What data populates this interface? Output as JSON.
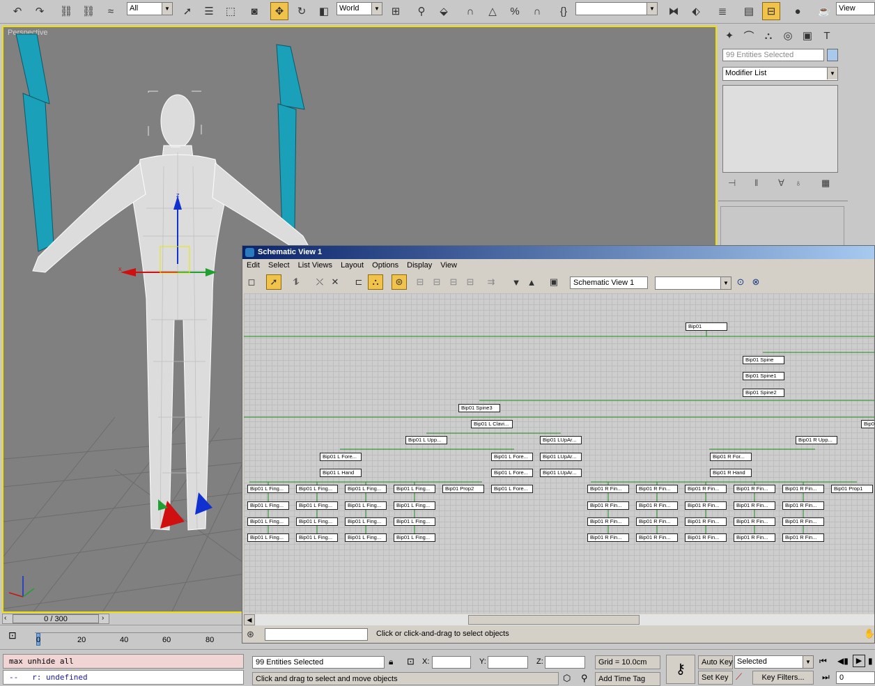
{
  "toolbar": {
    "selection_filter": "All",
    "reference_coord": "World",
    "named_selection": "",
    "view_label": "View"
  },
  "viewport": {
    "label": "Perspective",
    "axis_x": "x",
    "axis_z": "z"
  },
  "command_panel": {
    "selection_name": "99 Entities Selected",
    "modifier_list": "Modifier List"
  },
  "schematic": {
    "title": "Schematic View 1",
    "menu": [
      "Edit",
      "Select",
      "List Views",
      "Layout",
      "Options",
      "Display",
      "View"
    ],
    "view_name": "Schematic View 1",
    "status": "Click or click-and-drag to select objects",
    "nodes": [
      "Bip01",
      "Bip01 Spine",
      "Bip01 Spine1",
      "Bip01 Spine2",
      "Bip01 Spine3",
      "Bip01 L Clavi...",
      "Bip01 L Upp...",
      "Bip01 LUpAr...",
      "Bip01 R Upp...",
      "Bip01 L Fore...",
      "Bip01 L Hand",
      "Bip01 L Fore...",
      "Bip01 L Fore...",
      "Bip01 L Fore...",
      "Bip01 LUpAr...",
      "Bip01 LUpAr...",
      "Bip01 R For...",
      "Bip01 R Hand",
      "Bip01 L Fing...",
      "Bip01 L Fing...",
      "Bip01 L Fing...",
      "Bip01 L Fing...",
      "Bip01 Prop2",
      "Bip01 R Fin...",
      "Bip01 R Fin...",
      "Bip01 R Fin...",
      "Bip01 R Fin...",
      "Bip01 R Fin...",
      "Bip01 Prop1",
      "Bip01"
    ]
  },
  "timeline": {
    "frame": "0 / 300",
    "ticks": [
      "0",
      "20",
      "40",
      "60",
      "80"
    ]
  },
  "maxscript": {
    "input": "max unhide all",
    "output": "--   r: undefined"
  },
  "status_bar": {
    "selection": "99 Entities Selected",
    "x_label": "X:",
    "y_label": "Y:",
    "z_label": "Z:",
    "grid": "Grid = 10.0cm",
    "prompt": "Click and drag to select and move objects",
    "add_time_tag": "Add Time Tag",
    "auto_key": "Auto Key",
    "set_key": "Set Key",
    "key_mode": "Selected",
    "key_filters": "Key Filters...",
    "current_frame": "0"
  },
  "colors": {
    "viewport_bg": "#808080",
    "viewport_border": "#f0e000",
    "schematic_title_bg": "#0a246a",
    "schematic_wire": "#1f8a1f",
    "script_input_bg": "#f1d5d5",
    "active_button": "#f2c34a"
  }
}
